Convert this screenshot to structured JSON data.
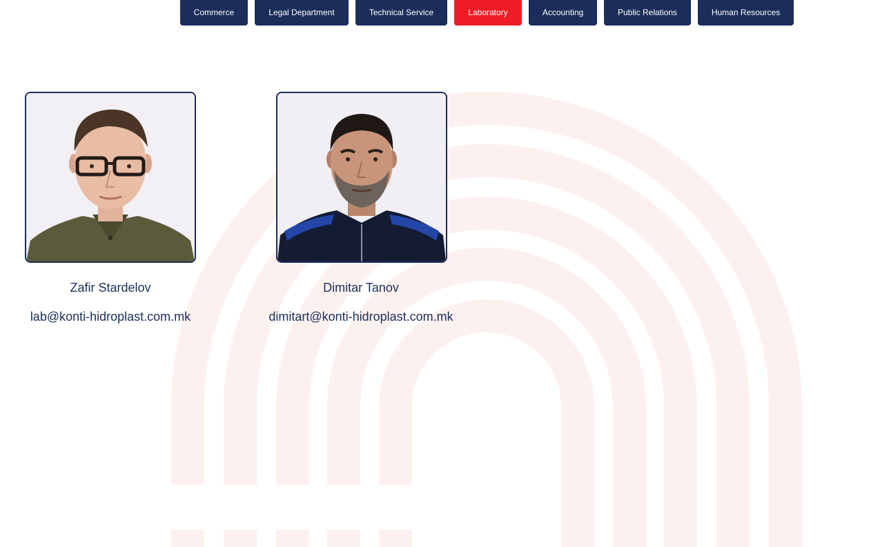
{
  "tabs": [
    {
      "label": "Commerce",
      "active": false
    },
    {
      "label": "Legal Department",
      "active": false
    },
    {
      "label": "Technical Service",
      "active": false
    },
    {
      "label": "Laboratory",
      "active": true
    },
    {
      "label": "Accounting",
      "active": false
    },
    {
      "label": "Public Relations",
      "active": false
    },
    {
      "label": "Human Resources",
      "active": false
    }
  ],
  "people": [
    {
      "name": "Zafir Stardelov",
      "email": "lab@konti-hidroplast.com.mk"
    },
    {
      "name": "Dimitar Tanov",
      "email": "dimitart@konti-hidroplast.com.mk"
    }
  ],
  "colors": {
    "navy": "#1b2d5a",
    "accent_red": "#ee1c25",
    "watermark": "#fdf1f0"
  }
}
